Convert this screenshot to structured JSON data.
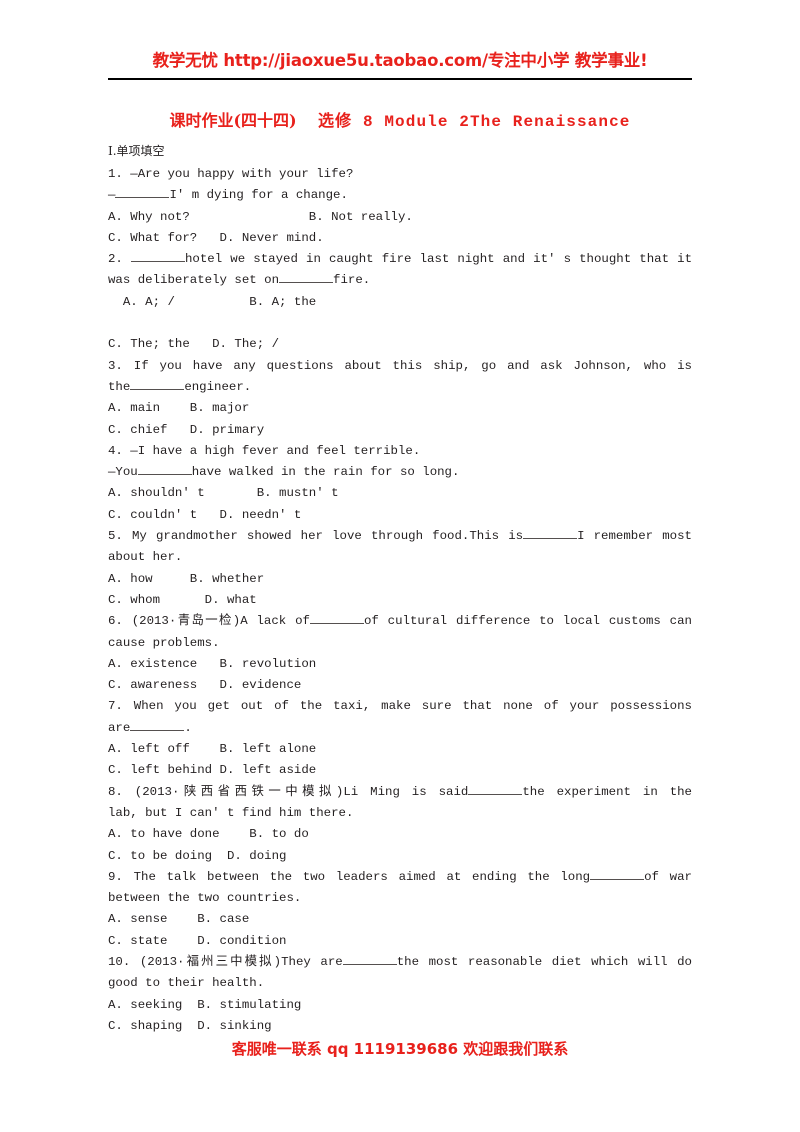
{
  "header": {
    "banner_text": "教学无忧 http://jiaoxue5u.taobao.com/专注中小学 教学事业!",
    "banner_color": "#e8211c",
    "rule_color": "#000000"
  },
  "title": {
    "cn_part": "课时作业(四十四)",
    "en_part": "选修 8  Module 2The Renaissance",
    "full": "课时作业(四十四)  选修 8  Module 2The Renaissance",
    "color": "#e8211c"
  },
  "section": {
    "label": "Ⅰ.单项填空"
  },
  "questions": [
    {
      "number": "1.",
      "stem_lines": [
        "1. —Are you happy with your life?",
        "—________I' m dying for a change."
      ],
      "options": [
        "A. Why not?                B. Not really.",
        "C. What for?   D. Never mind."
      ]
    },
    {
      "number": "2.",
      "stem_lines": [
        "2. ________hotel we stayed in caught fire last night and  it' s thought that it",
        "was deliberately set on________fire."
      ],
      "options": [
        "  A. A; /          B. A; the",
        "C. The; the   D. The; /"
      ]
    },
    {
      "number": "3.",
      "stem_lines": [
        "3. If you have any questions about this ship, go and ask Johnson, who is",
        "the________engineer."
      ],
      "options": [
        "A. main    B. major",
        "C. chief   D. primary"
      ]
    },
    {
      "number": "4.",
      "stem_lines": [
        "4. —I have a high fever and feel terrible.",
        "—You________have walked in the rain for so long."
      ],
      "options": [
        "A. shouldn' t       B. mustn' t",
        "C. couldn' t   D. needn' t"
      ]
    },
    {
      "number": "5.",
      "stem_lines": [
        "5. My grandmother showed her love through food.This is________I remember most",
        "about her."
      ],
      "options": [
        "A. how     B. whether",
        "C. whom      D. what"
      ]
    },
    {
      "number": "6.",
      "stem_lines": [
        "6. (2013·青岛一检)A lack of________of cultural difference to local customs can",
        "cause problems."
      ],
      "options": [
        "A. existence   B. revolution",
        "C. awareness   D. evidence"
      ]
    },
    {
      "number": "7.",
      "stem_lines": [
        "7. When you get out of the taxi, make sure that none of your possessions",
        "are________."
      ],
      "options": [
        "A. left off    B. left alone",
        "C. left behind D. left aside"
      ]
    },
    {
      "number": "8.",
      "stem_lines": [
        "8. (2013·陕西省西铁一中模拟)Li Ming is said________the experiment in the",
        "lab, but I can' t find him there."
      ],
      "options": [
        "A. to have done    B. to do",
        "C. to be doing  D. doing"
      ]
    },
    {
      "number": "9.",
      "stem_lines": [
        "9. The talk between the two leaders aimed at ending the long________of war",
        "between the two countries."
      ],
      "options": [
        "A. sense    B. case",
        "C. state    D. condition"
      ]
    },
    {
      "number": "10.",
      "stem_lines": [
        "10. (2013·福州三中模拟)They are________the most reasonable diet which will do",
        "good to their health."
      ],
      "options": [
        "A. seeking  B. stimulating",
        "C. shaping  D. sinking"
      ]
    }
  ],
  "footer": {
    "text": "客服唯一联系 qq   1119139686 欢迎跟我们联系",
    "color": "#e8211c"
  }
}
